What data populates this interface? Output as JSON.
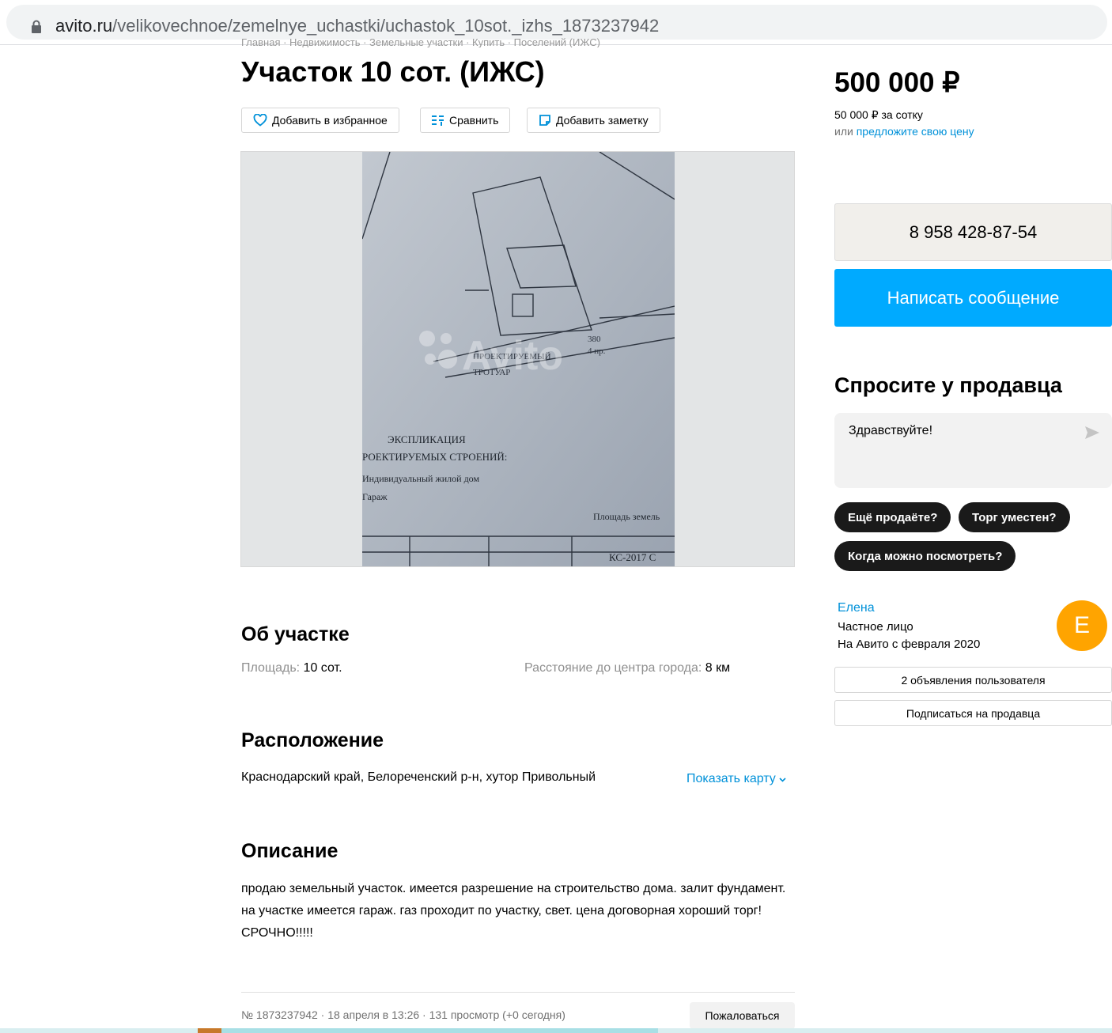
{
  "browser": {
    "url_host": "avito.ru",
    "url_path": "/velikovechnoe/zemelnye_uchastki/uchastok_10sot._izhs_1873237942"
  },
  "breadcrumb": "Главная · Недвижимость · Земельные участки · Купить · Поселений (ИЖС)",
  "listing": {
    "title": "Участок 10 сот. (ИЖС)",
    "actions": {
      "favorite": "Добавить в избранное",
      "compare": "Сравнить",
      "note": "Добавить заметку"
    },
    "photo_alt": "План участка",
    "about": {
      "heading": "Об участке",
      "area_label": "Площадь:",
      "area_value": "10 сот.",
      "distance_label": "Расстояние до центра города:",
      "distance_value": "8 км"
    },
    "location": {
      "heading": "Расположение",
      "address": "Краснодарский край, Белореченский р-н, хутор Привольный",
      "show_map": "Показать карту"
    },
    "description": {
      "heading": "Описание",
      "text": "продаю земельный участок. имеется разрешение на строительство дома. залит фундамент. на участке имеется гараж. газ проходит по участку, свет. цена договорная хороший торг! СРОЧНО!!!!!"
    },
    "meta": "№ 1873237942 · 18 апреля в 13:26 · 131 просмотр (+0 сегодня)",
    "complain": "Пожаловаться"
  },
  "sidebar": {
    "price": "500 000 ₽",
    "price_per": "50 000 ₽ за сотку",
    "offer_prefix": "или",
    "offer_link": "предложите свою цену",
    "phone": "8 958 428-87-54",
    "message": "Написать сообщение",
    "ask_heading": "Спросите у продавца",
    "ask_value": "Здравствуйте!",
    "chips": [
      "Ещё продаёте?",
      "Торг уместен?",
      "Когда можно посмотреть?"
    ],
    "seller": {
      "name": "Елена",
      "type": "Частное лицо",
      "since": "На Авито с февраля 2020",
      "avatar_letter": "Е"
    },
    "user_ads": "2 объявления пользователя",
    "subscribe": "Подписаться на продавца"
  },
  "colors": {
    "link": "#0091d9",
    "primary": "#00aaff",
    "avatar": "#ffa400"
  }
}
